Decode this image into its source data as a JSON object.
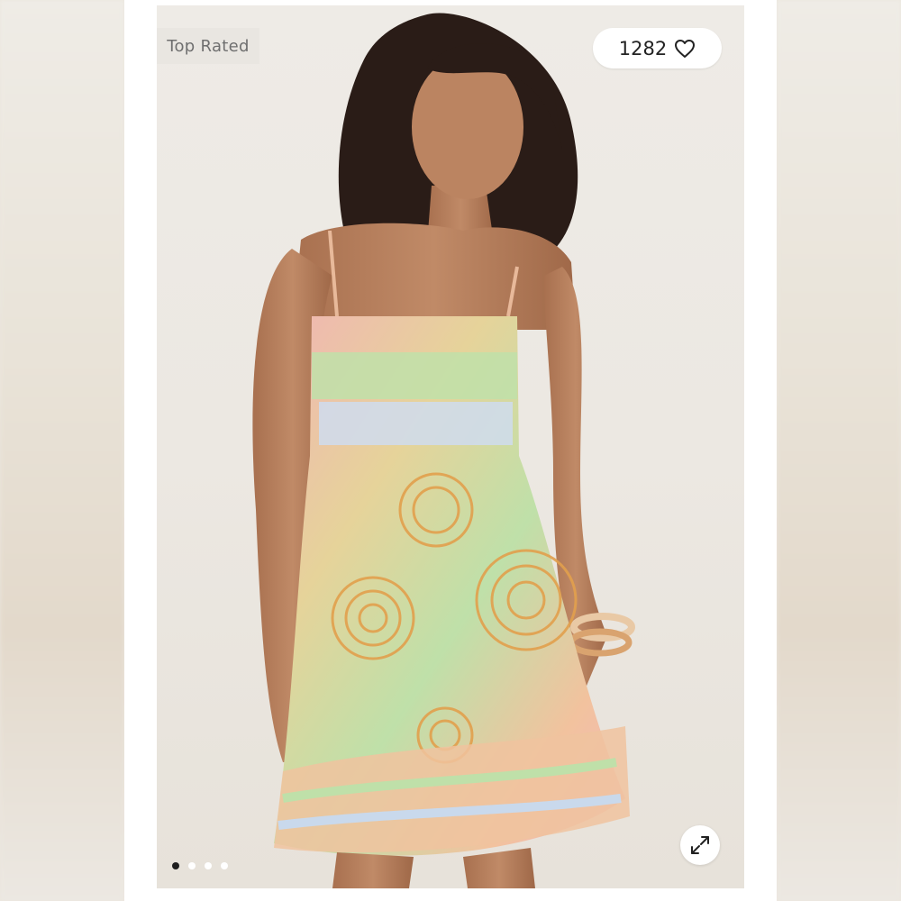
{
  "listing": {
    "badge_label": "Top Rated",
    "like_count": "1282",
    "like_icon": "heart-outline-icon",
    "expand_icon": "expand-arrows-icon",
    "carousel": {
      "total": 4,
      "active_index": 0
    }
  },
  "colors": {
    "dress_pink": "#f2b4b8",
    "dress_green": "#b9dca0",
    "dress_blue": "#c9d9ec",
    "dress_orange": "#e9a95b",
    "skin": "#b07a5a",
    "hair": "#2a1c17"
  }
}
